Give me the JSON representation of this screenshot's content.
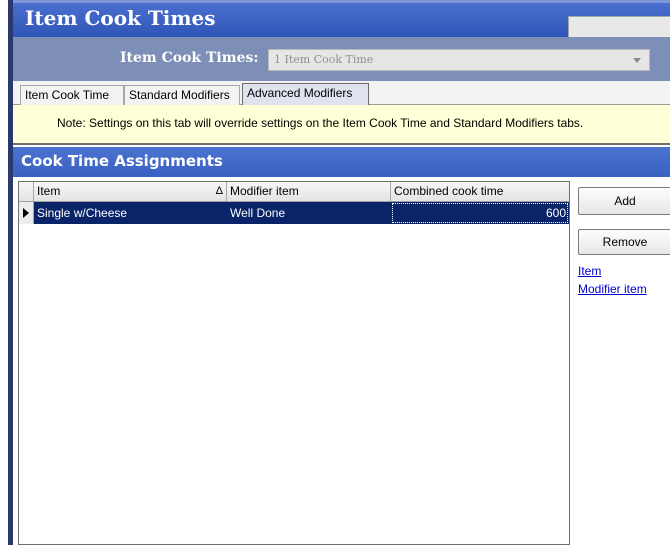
{
  "window": {
    "title": "Item Cook Times"
  },
  "selector": {
    "label": "Item Cook Times:",
    "value": "1 Item Cook Time"
  },
  "tabs": [
    {
      "label": "Item Cook Time",
      "active": false
    },
    {
      "label": "Standard Modifiers",
      "active": false
    },
    {
      "label": "Advanced Modifiers",
      "active": true
    }
  ],
  "note": "Note: Settings on this tab will override settings on the Item Cook Time and Standard Modifiers tabs.",
  "section": {
    "title": "Cook Time Assignments"
  },
  "grid": {
    "columns": [
      "Item",
      "Modifier item",
      "Combined cook time"
    ],
    "sort_indicator": "Δ",
    "rows": [
      {
        "item": "Single w/Cheese",
        "modifier": "Well Done",
        "cook_time": "600",
        "selected": true
      }
    ]
  },
  "actions": {
    "add_label": "Add",
    "remove_label": "Remove"
  },
  "links": [
    "Item",
    "Modifier item"
  ],
  "colors": {
    "title_bar": "#2f55b8",
    "selection": "#0a246a",
    "note_background": "#ffffd8"
  }
}
